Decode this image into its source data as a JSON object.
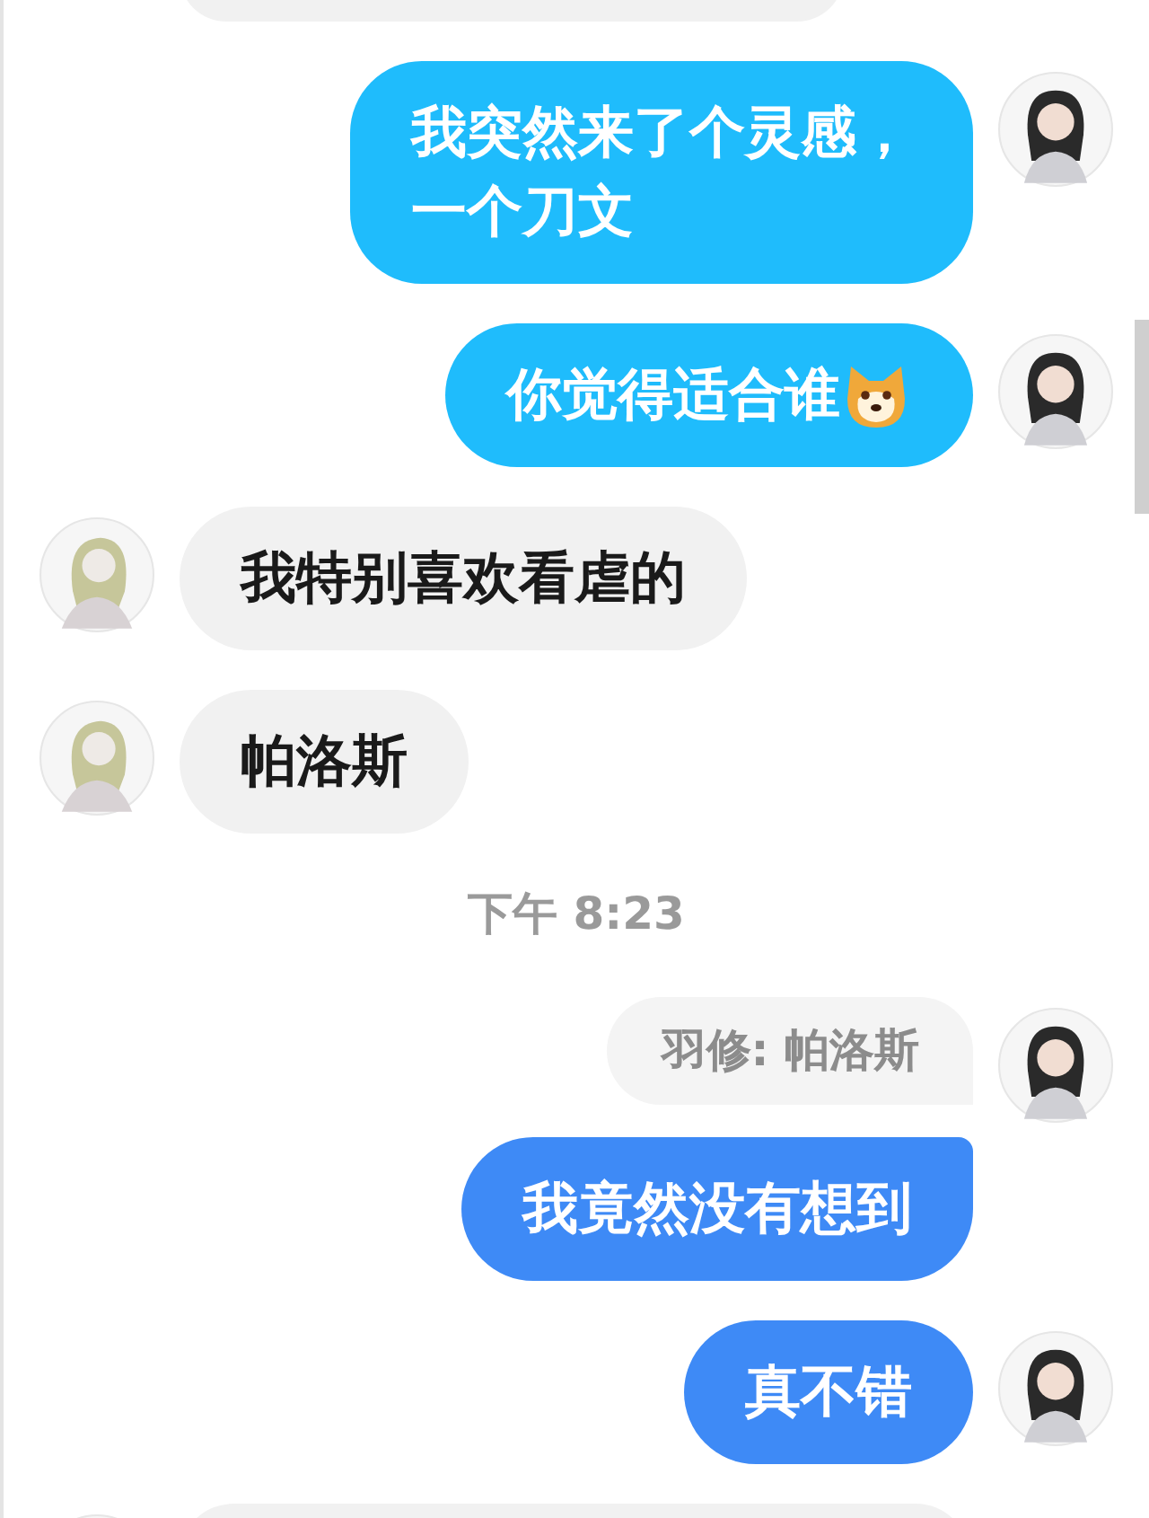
{
  "messages": [
    {
      "kind": "cut"
    },
    {
      "kind": "sent",
      "lines": [
        "我突然来了个灵感，",
        "一个刀文"
      ],
      "color": "#1fbcfc",
      "emoji": false
    },
    {
      "kind": "sent",
      "lines": [
        "你觉得适合谁"
      ],
      "color": "#1fbcfc",
      "emoji": true
    },
    {
      "kind": "received",
      "lines": [
        "我特别喜欢看虐的"
      ]
    },
    {
      "kind": "received",
      "lines": [
        "帕洛斯"
      ]
    },
    {
      "kind": "time",
      "text": "下午 8:23"
    },
    {
      "kind": "quote",
      "text": "羽修: 帕洛斯"
    },
    {
      "kind": "sent",
      "lines": [
        "我竟然没有想到"
      ],
      "color": "#3e8af6",
      "emoji": false
    },
    {
      "kind": "sent",
      "lines": [
        "真不错"
      ],
      "color": "#3e8af6",
      "emoji": false
    },
    {
      "kind": "cut"
    }
  ]
}
